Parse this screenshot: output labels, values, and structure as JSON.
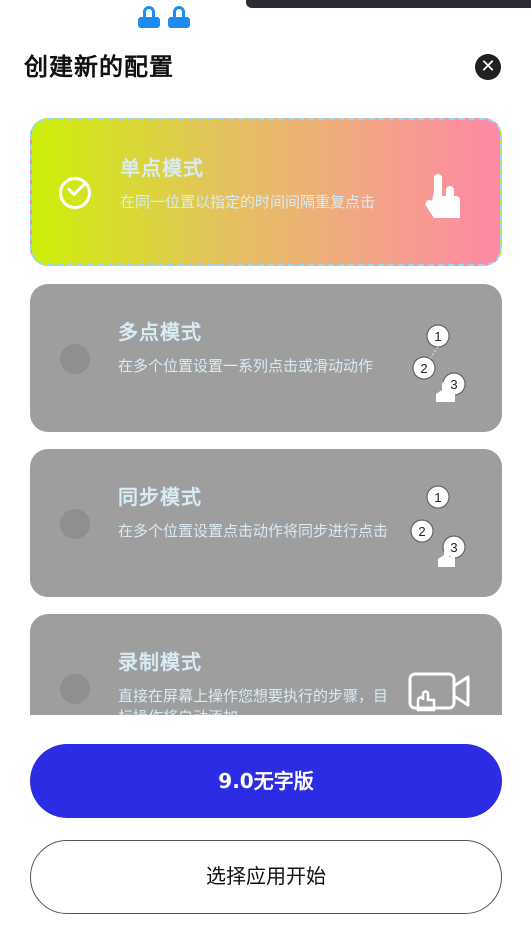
{
  "header": {
    "title": "创建新的配置",
    "close_icon": "close-icon"
  },
  "modes": [
    {
      "title": "单点模式",
      "description": "在同一位置以指定的时间间隔重复点击",
      "selected": true,
      "icon": "single-tap-icon"
    },
    {
      "title": "多点模式",
      "description": "在多个位置设置一系列点击或滑动动作",
      "selected": false,
      "icon": "multi-tap-icon",
      "steps": [
        "1",
        "2",
        "3"
      ]
    },
    {
      "title": "同步模式",
      "description": "在多个位置设置点击动作将同步进行点击",
      "selected": false,
      "icon": "sync-tap-icon",
      "steps": [
        "1",
        "2",
        "3"
      ]
    },
    {
      "title": "录制模式",
      "description": "直接在屏幕上操作您想要执行的步骤，目标操作将自动添加",
      "selected": false,
      "icon": "record-icon"
    }
  ],
  "buttons": {
    "primary": "9.0无字版",
    "secondary": "选择应用开始"
  },
  "colors": {
    "primary": "#2c2ce4",
    "card_gray": "#9e9e9e",
    "gradient_start": "#cdf008",
    "gradient_end": "#ff88a6"
  }
}
